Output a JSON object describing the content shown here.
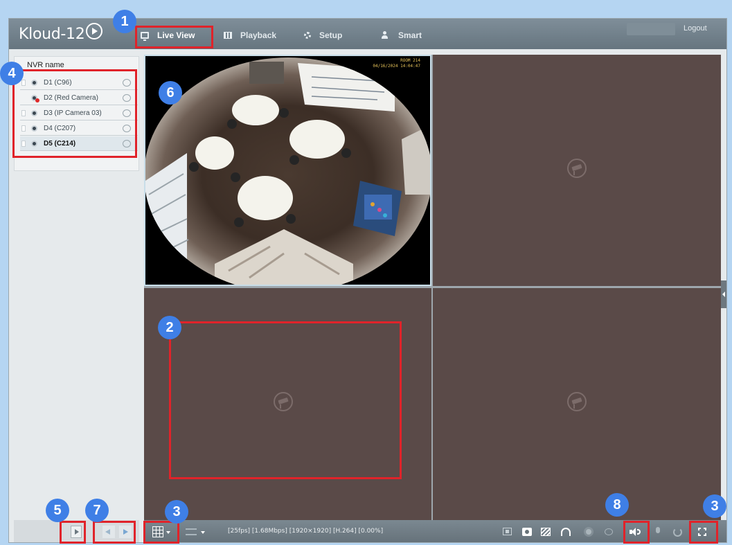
{
  "app": {
    "logo_text": "Kloud-12",
    "nav": [
      {
        "label": "Live View",
        "active": true,
        "icon": "monitor-icon"
      },
      {
        "label": "Playback",
        "active": false,
        "icon": "film-icon"
      },
      {
        "label": "Setup",
        "active": false,
        "icon": "gear-icon"
      },
      {
        "label": "Smart",
        "active": false,
        "icon": "person-icon"
      }
    ],
    "logout_label": "Logout"
  },
  "sidebar": {
    "title": "NVR name",
    "devices": [
      {
        "label": "D1 (C96)",
        "selected": false,
        "status": "online"
      },
      {
        "label": "D2 (Red Camera)",
        "selected": false,
        "status": "error"
      },
      {
        "label": "D3 (IP Camera 03)",
        "selected": false,
        "status": "online"
      },
      {
        "label": "D4 (C207)",
        "selected": false,
        "status": "online"
      },
      {
        "label": "D5 (C214)",
        "selected": true,
        "status": "online"
      }
    ]
  },
  "video": {
    "osd_title": "ROOM 214",
    "osd_time": "04/16/2024 14:04:47"
  },
  "toolbar": {
    "status_text": "[25fps] [1.68Mbps] [1920×1920] [H.264] [0.00%]",
    "icons": [
      "grid-layout-icon",
      "stream-type-icon",
      "record-icon",
      "snapshot-icon",
      "clip-icon",
      "two-way-audio-icon",
      "ptz-icon",
      "digital-zoom-icon",
      "audio-icon",
      "microphone-icon",
      "refresh-icon",
      "fullscreen-icon"
    ]
  },
  "annotations": {
    "badges": [
      "1",
      "2",
      "3",
      "4",
      "5",
      "6",
      "7",
      "8",
      "3"
    ],
    "highlight_color": "#e0232a",
    "badge_color": "#3f7fe6"
  }
}
